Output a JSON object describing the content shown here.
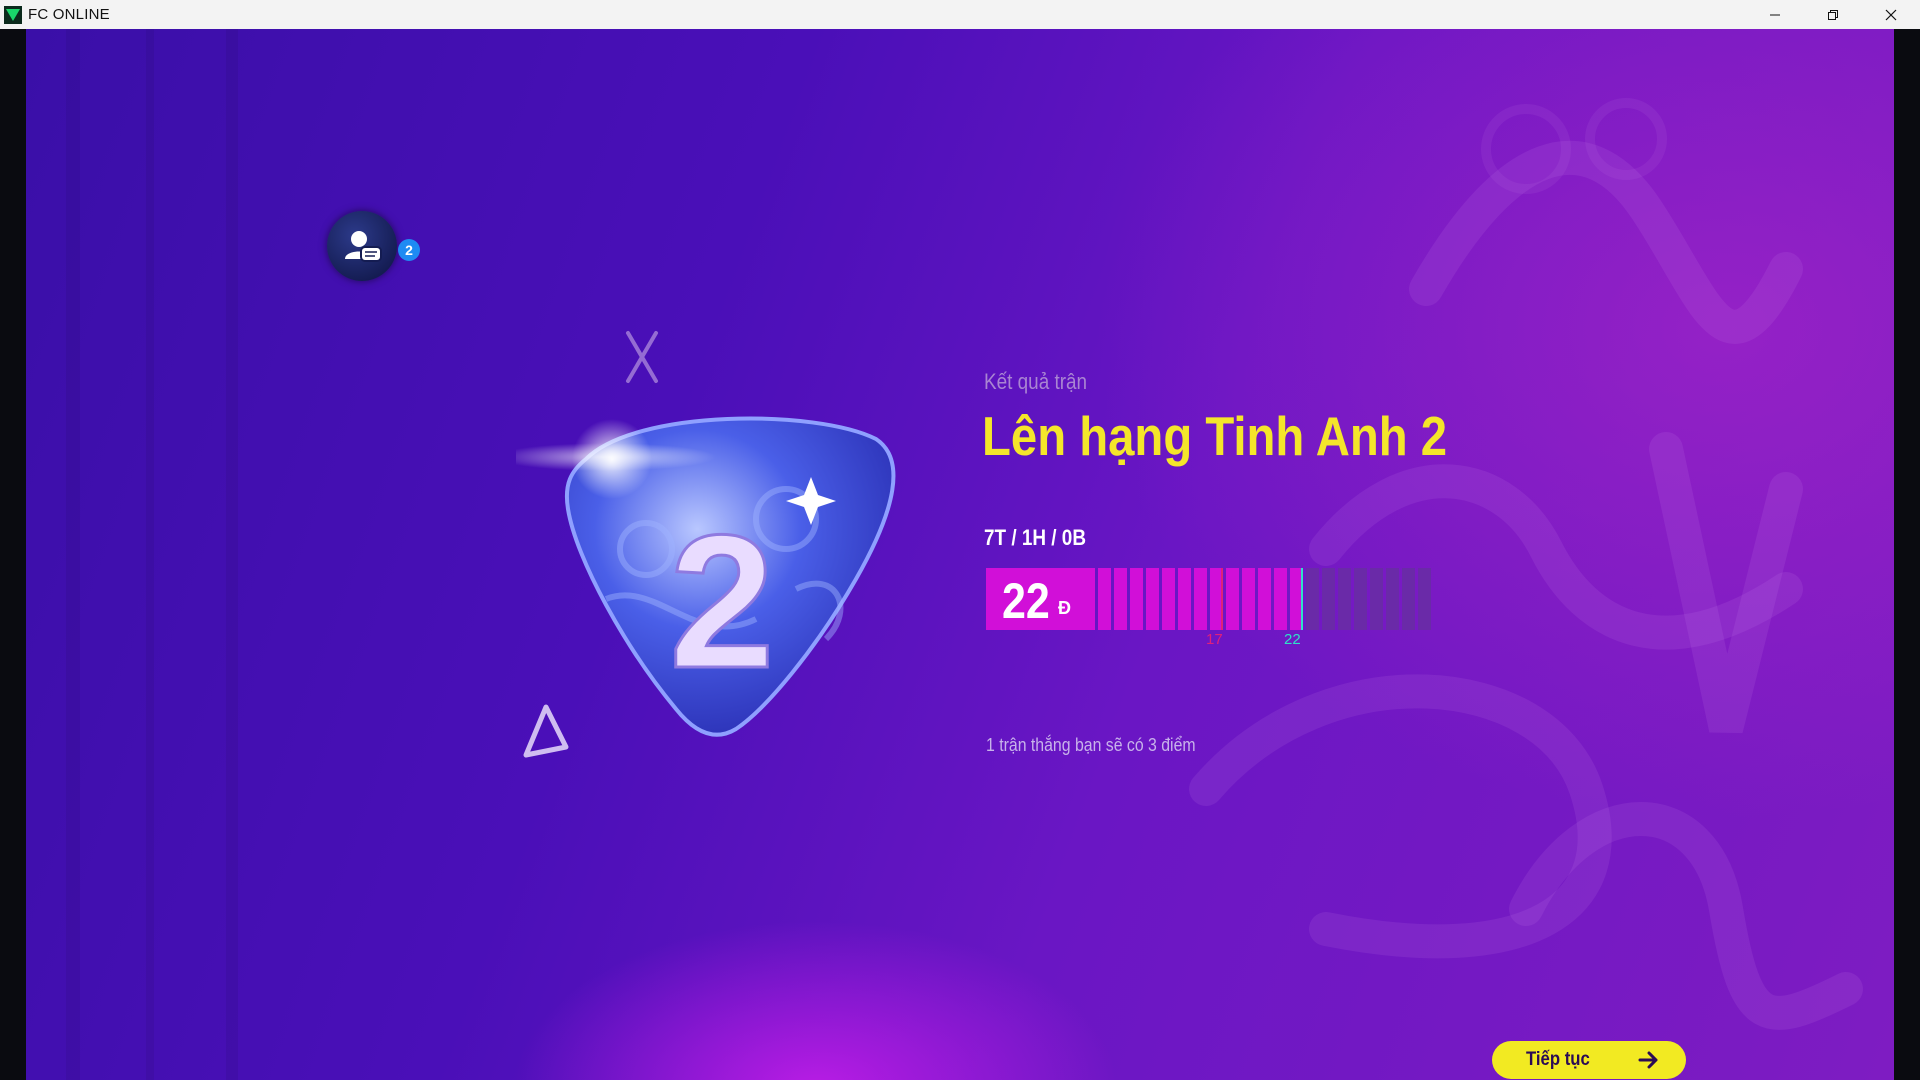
{
  "window": {
    "title": "FC ONLINE",
    "icon": "fc-online-logo-icon",
    "controls": [
      "minimize-icon",
      "restore-icon",
      "close-icon"
    ]
  },
  "social": {
    "badge_count": "2",
    "icon": "friends-chat-icon"
  },
  "rank": {
    "emblem_number": "2"
  },
  "result": {
    "section_label": "Kết quả trận",
    "title": "Lên hạng Tinh Anh 2",
    "record": "7T / 1H / 0B"
  },
  "points": {
    "value": "22",
    "unit": "Đ",
    "previous_marker": "17",
    "current_marker": "22",
    "total_segments": 30,
    "filled_segments": 22,
    "colors": {
      "fill": "#d10fd8",
      "empty": "#6a2aa8",
      "previous": "#e0207a",
      "current": "#2fe0c8"
    }
  },
  "hint": "1 trận thắng bạn sẽ có 3 điểm",
  "continue_button": {
    "label": "Tiếp tục",
    "icon": "arrow-right-icon"
  },
  "colors": {
    "title_yellow": "#f4e62a",
    "button_yellow": "#f2ea22"
  }
}
